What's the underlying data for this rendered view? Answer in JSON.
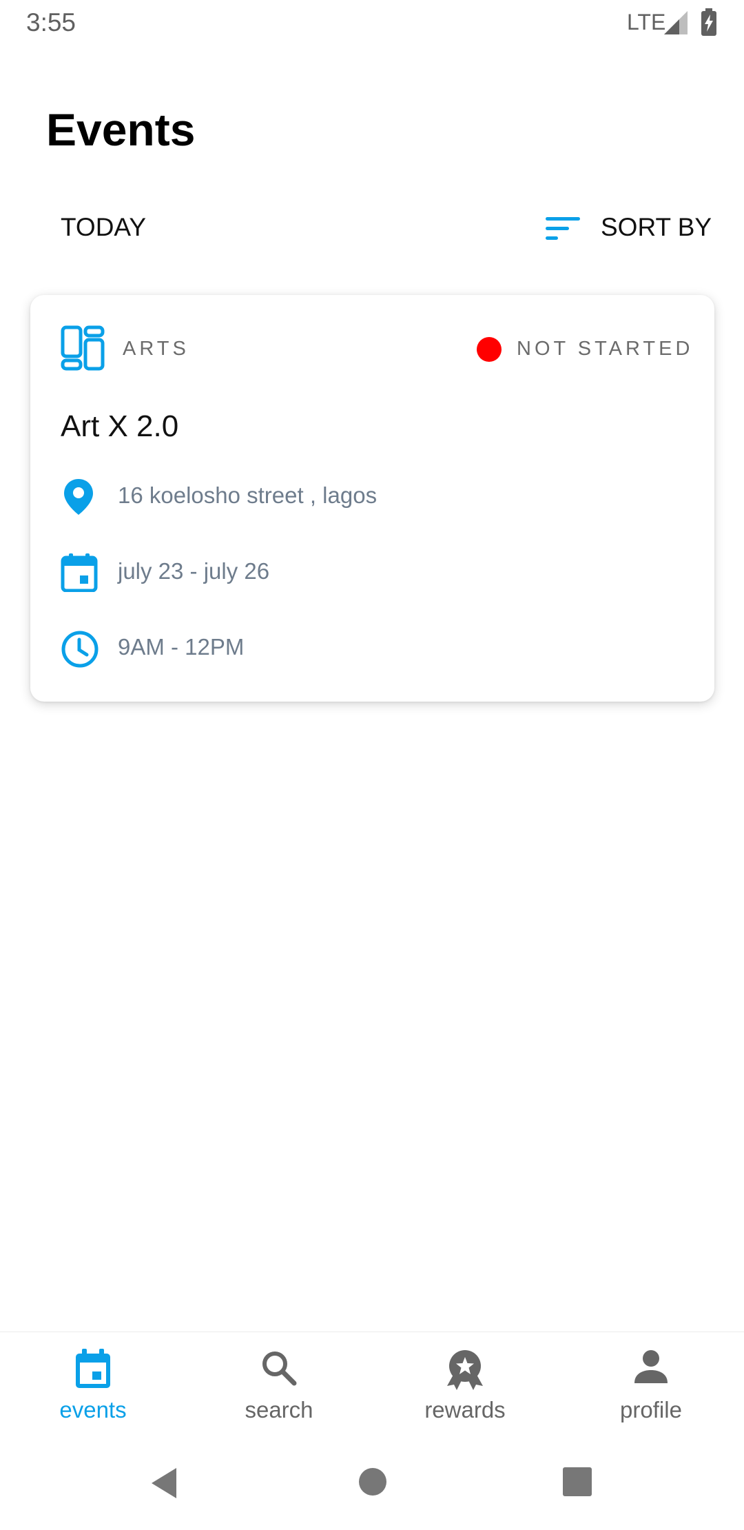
{
  "status_bar": {
    "time": "3:55",
    "network": "LTE"
  },
  "page": {
    "title": "Events"
  },
  "filter_bar": {
    "today_label": "TODAY",
    "sort_label": "SORT BY"
  },
  "event": {
    "category": "ARTS",
    "status": "NOT STARTED",
    "status_color": "#ff0000",
    "title": "Art X 2.0",
    "location": "16 koelosho street , lagos",
    "dates": "july 23 - july 26",
    "time": "9AM - 12PM"
  },
  "bottom_nav": {
    "items": [
      {
        "label": "events",
        "icon": "calendar-icon",
        "active": true
      },
      {
        "label": "search",
        "icon": "search-icon",
        "active": false
      },
      {
        "label": "rewards",
        "icon": "award-icon",
        "active": false
      },
      {
        "label": "profile",
        "icon": "person-icon",
        "active": false
      }
    ]
  },
  "colors": {
    "accent": "#0aa0e8",
    "muted_text": "#6e7c8c",
    "nav_inactive": "#666666"
  }
}
